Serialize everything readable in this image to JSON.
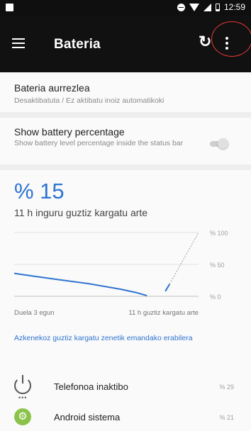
{
  "status_bar": {
    "time": "12:59"
  },
  "toolbar": {
    "title": "Bateria"
  },
  "battery_saver": {
    "title": "Bateria aurrezlea",
    "summary": "Desaktibatuta / Ez aktibatu inoiz automatikoki"
  },
  "show_percentage": {
    "title": "Show battery percentage",
    "summary": "Show battery level percentage inside the status bar",
    "enabled": false
  },
  "battery": {
    "level": "% 15",
    "estimate": "11 h inguru guztiz kargatu arte"
  },
  "chart_data": {
    "type": "line",
    "y_tick_labels": [
      "% 100",
      "% 50",
      "% 0"
    ],
    "ylim": [
      0,
      100
    ],
    "x_labels": {
      "start": "Duela 3 egun",
      "end": "11 h guztiz kargatu arte"
    },
    "series": [
      {
        "values": [
          {
            "x": 0.0,
            "y": 36
          },
          {
            "x": 0.12,
            "y": 31
          },
          {
            "x": 0.22,
            "y": 27
          },
          {
            "x": 0.32,
            "y": 23
          },
          {
            "x": 0.4,
            "y": 20
          },
          {
            "x": 0.5,
            "y": 15
          },
          {
            "x": 0.58,
            "y": 11
          },
          {
            "x": 0.66,
            "y": 6
          },
          {
            "x": 0.72,
            "y": 1
          }
        ]
      }
    ],
    "projection": [
      {
        "x": 0.82,
        "y": 8
      },
      {
        "x": 1.0,
        "y": 100
      }
    ],
    "grid": true
  },
  "recent_usage_link": "Azkenekoz guztiz kargatu zenetik emandako erabilera",
  "apps": [
    {
      "name": "Telefonoa inaktibo",
      "percent": "% 29",
      "icon": "power-icon"
    },
    {
      "name": "Android sistema",
      "percent": "% 21",
      "icon": "android-gear-icon"
    }
  ],
  "colors": {
    "accent": "#2f74d0",
    "toolbar": "#111111",
    "highlight": "#e53935"
  }
}
